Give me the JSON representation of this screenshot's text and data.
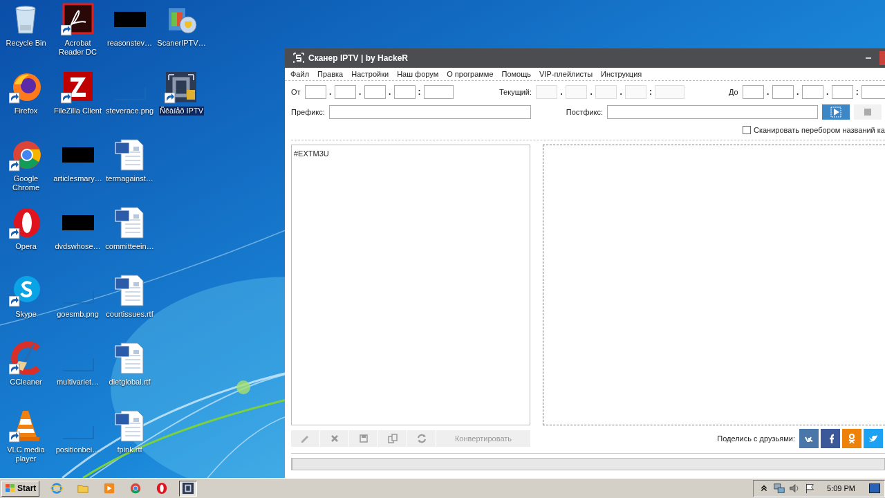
{
  "desktop": {
    "icons": [
      {
        "label": "Recycle Bin",
        "kind": "recycle",
        "shortcut": false,
        "selected": false
      },
      {
        "label": "Firefox",
        "kind": "firefox",
        "shortcut": true,
        "selected": false
      },
      {
        "label": "Google Chrome",
        "kind": "chrome",
        "shortcut": true,
        "selected": false
      },
      {
        "label": "Opera",
        "kind": "opera",
        "shortcut": true,
        "selected": false
      },
      {
        "label": "Skype",
        "kind": "skype",
        "shortcut": true,
        "selected": false
      },
      {
        "label": "CCleaner",
        "kind": "ccleaner",
        "shortcut": true,
        "selected": false
      },
      {
        "label": "VLC media player",
        "kind": "vlc",
        "shortcut": true,
        "selected": false
      },
      {
        "label": "Acrobat Reader DC",
        "kind": "acrobat",
        "shortcut": true,
        "selected": false
      },
      {
        "label": "FileZilla Client",
        "kind": "filezilla",
        "shortcut": true,
        "selected": false
      },
      {
        "label": "articlesmary…",
        "kind": "redacted",
        "shortcut": false,
        "selected": false
      },
      {
        "label": "dvdswhose…",
        "kind": "redacted",
        "shortcut": false,
        "selected": false
      },
      {
        "label": "goesmb.png",
        "kind": "blank",
        "shortcut": false,
        "selected": false
      },
      {
        "label": "multivariet…",
        "kind": "blank",
        "shortcut": false,
        "selected": false
      },
      {
        "label": "positionbei…",
        "kind": "blank",
        "shortcut": false,
        "selected": false
      },
      {
        "label": "reasonstev…",
        "kind": "redacted",
        "shortcut": false,
        "selected": false
      },
      {
        "label": "steverace.png",
        "kind": "blank",
        "shortcut": false,
        "selected": false
      },
      {
        "label": "termagainst…",
        "kind": "word",
        "shortcut": false,
        "selected": false
      },
      {
        "label": "committeein…",
        "kind": "word",
        "shortcut": false,
        "selected": false
      },
      {
        "label": "courtissues.rtf",
        "kind": "word",
        "shortcut": false,
        "selected": false
      },
      {
        "label": "dietglobal.rtf",
        "kind": "word",
        "shortcut": false,
        "selected": false
      },
      {
        "label": "fpink.rtf",
        "kind": "word",
        "shortcut": false,
        "selected": false
      },
      {
        "label": "ScanerIPTV…",
        "kind": "installer",
        "shortcut": false,
        "selected": false
      },
      {
        "label": "Ñêàíåð IPTV",
        "kind": "scaner",
        "shortcut": true,
        "selected": true
      }
    ]
  },
  "window": {
    "title": "Сканер IPTV | by HackeR",
    "menu": [
      "Файл",
      "Правка",
      "Настройки",
      "Наш форум",
      "О программе",
      "Помощь",
      "VIP-плейлисты",
      "Инструкция"
    ],
    "ip_groups": [
      {
        "label": "От",
        "disabled": false,
        "separators": [
          ".",
          ".",
          ".",
          ":"
        ]
      },
      {
        "label": "Текущий:",
        "disabled": true,
        "separators": [
          ".",
          ".",
          ".",
          ":"
        ]
      },
      {
        "label": "До",
        "disabled": false,
        "separators": [
          ".",
          ".",
          ".",
          ":"
        ]
      }
    ],
    "prefix": {
      "label": "Префикс:"
    },
    "postfix": {
      "label": "Постфикс:"
    },
    "controls": [
      {
        "kind": "play",
        "disabled": false
      },
      {
        "kind": "stop",
        "disabled": true
      }
    ],
    "scan_names": {
      "label": "Сканировать перебором названий ка",
      "checked": false
    },
    "playlist": {
      "value": "#EXTM3U"
    },
    "tools": [
      {
        "kind": "edit"
      },
      {
        "kind": "delete"
      },
      {
        "kind": "save"
      },
      {
        "kind": "copy"
      },
      {
        "kind": "refresh"
      }
    ],
    "convert_button": {
      "label": "Конвертировать",
      "disabled": true
    },
    "share": {
      "label": "Поделись с друзьями:",
      "networks": [
        {
          "kind": "vk"
        },
        {
          "kind": "facebook"
        },
        {
          "kind": "odnoklassniki"
        },
        {
          "kind": "twitter"
        }
      ]
    },
    "progress": {
      "level": 0
    }
  },
  "taskbar": {
    "start": "Start",
    "apps": [
      {
        "kind": "ie",
        "selected": false
      },
      {
        "kind": "explorer",
        "selected": false
      },
      {
        "kind": "media",
        "selected": false
      },
      {
        "kind": "chrome",
        "selected": false
      },
      {
        "kind": "opera",
        "selected": false
      },
      {
        "kind": "scaner",
        "selected": true
      }
    ],
    "tray": [
      {
        "kind": "chevron"
      },
      {
        "kind": "network"
      },
      {
        "kind": "volume"
      },
      {
        "kind": "flag"
      }
    ],
    "clock": "5:09 PM"
  }
}
